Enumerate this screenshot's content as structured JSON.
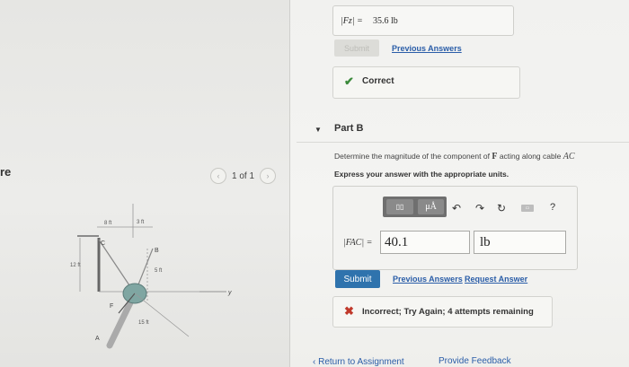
{
  "left": {
    "cut_label": "re",
    "pager": {
      "prev": "‹",
      "text": "1 of 1",
      "next": "›"
    },
    "figure": {
      "dim_8ft": "8 ft",
      "dim_3ft": "3 ft",
      "dim_12ft": "12 ft",
      "dim_5ft": "5 ft",
      "dim_15ft": "15 ft",
      "pt_c": "C",
      "pt_b": "B",
      "pt_a": "A",
      "pt_f": "F",
      "axis_y": "y"
    }
  },
  "part_a": {
    "answer_label": "|Fz| =",
    "answer_value": "35.6 lb",
    "submit_label": "Submit",
    "previous_answers_label": "Previous Answers",
    "feedback_text": "Correct"
  },
  "part_b": {
    "title": "Part B",
    "question_prefix": "Determine the magnitude of the component of",
    "question_bold": "F",
    "question_mid": "acting along cable",
    "question_ital": "AC",
    "instruction": "Express your answer with the appropriate units.",
    "toolbar": {
      "template_label": "▯▯",
      "mu_label": "μÅ",
      "help_label": "?"
    },
    "input_label": "|FAC| =",
    "input_value": "40.1",
    "unit_value": "lb",
    "submit_label": "Submit",
    "previous_answers_label": "Previous Answers",
    "request_answer_label": "Request Answer",
    "feedback_text": "Incorrect; Try Again; 4 attempts remaining"
  },
  "footer": {
    "return_label": "‹ Return to Assignment",
    "feedback_label": "Provide Feedback"
  },
  "colors": {
    "link": "#2a5da8",
    "submit": "#2f73ad",
    "correct": "#3b8a3b",
    "incorrect": "#c0392b"
  }
}
